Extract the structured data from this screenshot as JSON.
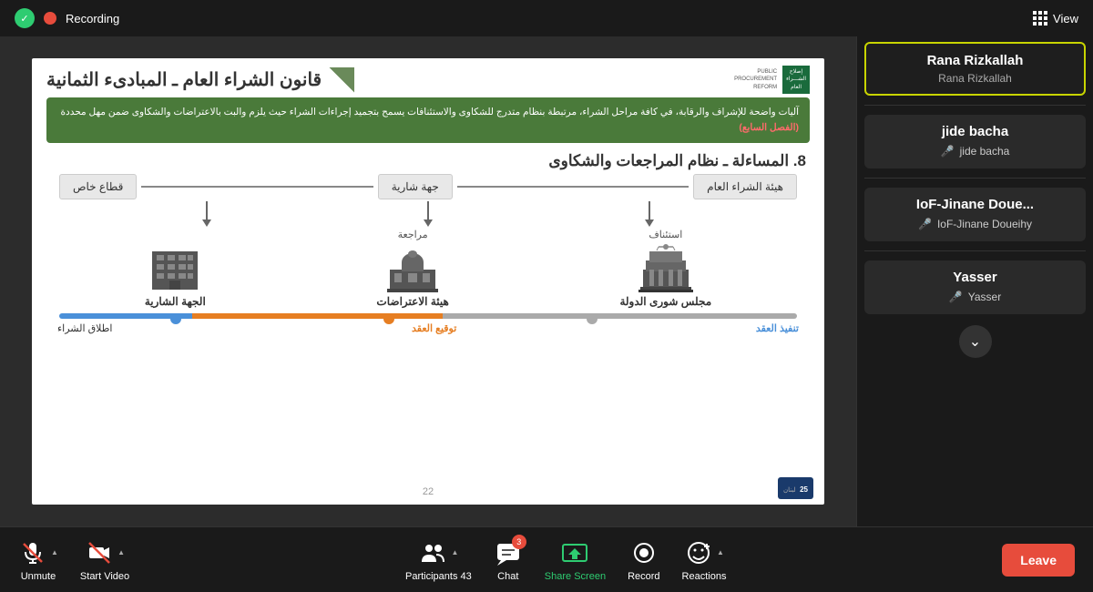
{
  "topbar": {
    "recording_label": "Recording",
    "view_label": "View"
  },
  "slide": {
    "title": "قانون الشراء العام ـ المبادىء الثمانية",
    "section_number": "8.",
    "section_title": "المساءلة ـ نظام المراجعات والشكاوى",
    "green_box_text": "آليات واضحة للإشراف والرقابة، في كافة مراحل الشراء، مرتبطة بنظام متدرج للشكاوى والاستئنافات يسمح بتجميد إجراءات الشراء حيث يلزم والبت بالاعتراضات والشكاوى ضمن مهل محددة",
    "highlight_text": "(الفصل السابع)",
    "boxes": {
      "box1": "هيئة الشراء العام",
      "box2": "جهة شارية",
      "box3": "قطاع خاص"
    },
    "building_labels": {
      "appeal": "استئناف",
      "review": "مراجعة",
      "building1": "مجلس شورى الدولة",
      "building2": "هيئة الاعتراضات",
      "building3": "الجهة الشارية"
    },
    "timeline": {
      "label1": "تنفيذ العقد",
      "label2": "توقيع العقد",
      "label3": "اطلاق الشراء"
    },
    "slide_number": "22"
  },
  "sidebar": {
    "participants": [
      {
        "name": "Rana Rizkallah",
        "sub": "Rana Rizkallah",
        "highlighted": true,
        "muted": false
      },
      {
        "name": "jide bacha",
        "sub": "jide bacha",
        "highlighted": false,
        "muted": true
      },
      {
        "name": "IoF-Jinane  Doue...",
        "sub": "IoF-Jinane Doueihy",
        "highlighted": false,
        "muted": true
      },
      {
        "name": "Yasser",
        "sub": "Yasser",
        "highlighted": false,
        "muted": true
      }
    ]
  },
  "toolbar": {
    "unmute_label": "Unmute",
    "start_video_label": "Start Video",
    "participants_label": "Participants",
    "participants_count": "43",
    "chat_label": "Chat",
    "chat_badge": "3",
    "share_screen_label": "Share Screen",
    "record_label": "Record",
    "reactions_label": "Reactions",
    "leave_label": "Leave"
  }
}
